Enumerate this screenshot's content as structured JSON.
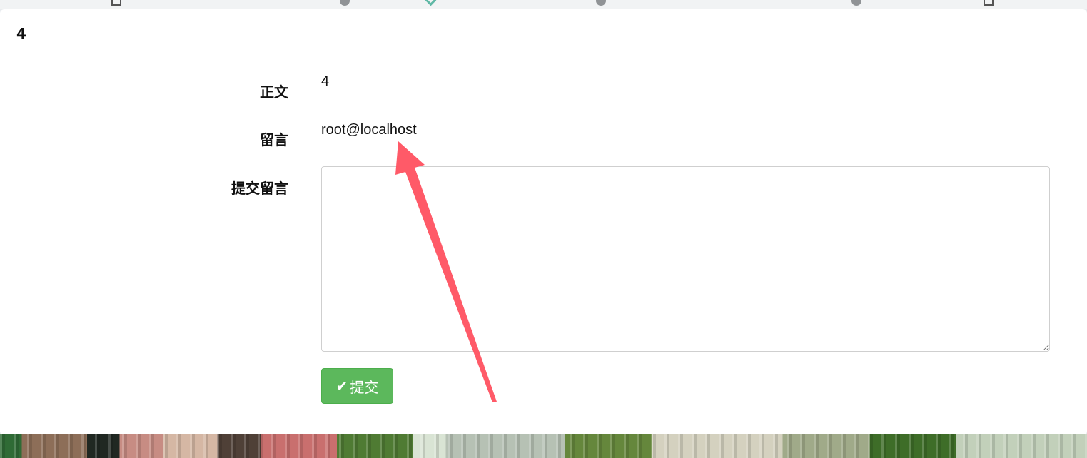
{
  "page": {
    "title": "4"
  },
  "fields": {
    "body_label": "正文",
    "body_value": "4",
    "message_label": "留言",
    "message_value": "root@localhost",
    "submit_message_label": "提交留言"
  },
  "form": {
    "textarea_value": "",
    "submit_label": "提交"
  },
  "icons": {
    "submit_icon": "check-icon",
    "annotation_arrow": "red-arrow"
  },
  "colors": {
    "success": "#5cb85c",
    "arrow": "#ff5a68"
  }
}
